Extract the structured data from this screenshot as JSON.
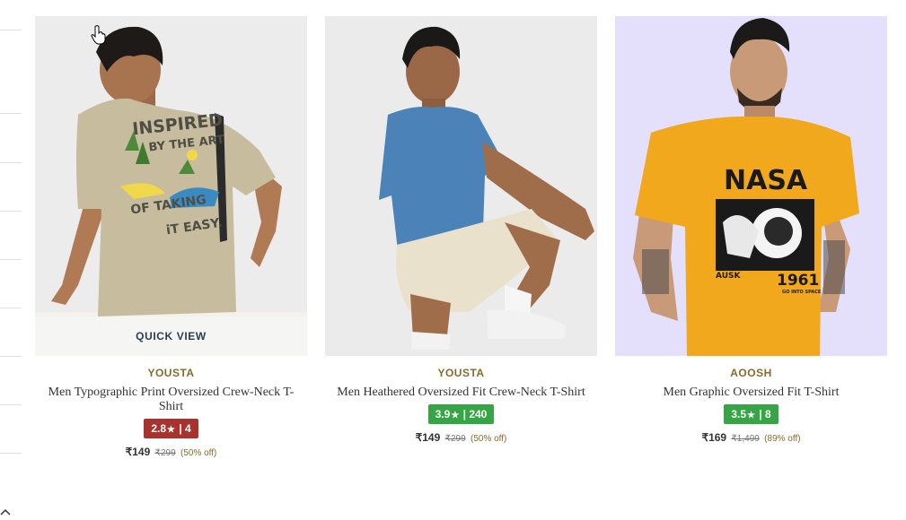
{
  "colors": {
    "brand_text": "#8a6a2b",
    "rating_low": "#a8322e",
    "rating_good": "#36a546"
  },
  "quick_view_label": "QUICK VIEW",
  "products": [
    {
      "brand": "YOUSTA",
      "name": "Men Typographic Print Oversized Crew-Neck T-Shirt",
      "rating": "2.8",
      "star": "★",
      "reviews": "| 4",
      "rating_color": "#a8322e",
      "price": "₹149",
      "mrp": "₹299",
      "discount": "(50% off)",
      "print_text": [
        "INSPIRED",
        "BY THE ART",
        "OF TAKING",
        "iT EASY."
      ]
    },
    {
      "brand": "YOUSTA",
      "name": "Men Heathered Oversized Fit Crew-Neck T-Shirt",
      "rating": "3.9",
      "star": "★",
      "reviews": "| 240",
      "rating_color": "#36a546",
      "price": "₹149",
      "mrp": "₹299",
      "discount": "(50% off)"
    },
    {
      "brand": "AOOSH",
      "name": "Men Graphic Oversized Fit T-Shirt",
      "rating": "3.5",
      "star": "★",
      "reviews": "| 8",
      "rating_color": "#36a546",
      "price": "₹169",
      "mrp": "₹1,499",
      "discount": "(89% off)",
      "print_text": [
        "NASA",
        "AUSK",
        "1961",
        "GO INTO SPACE"
      ]
    }
  ]
}
